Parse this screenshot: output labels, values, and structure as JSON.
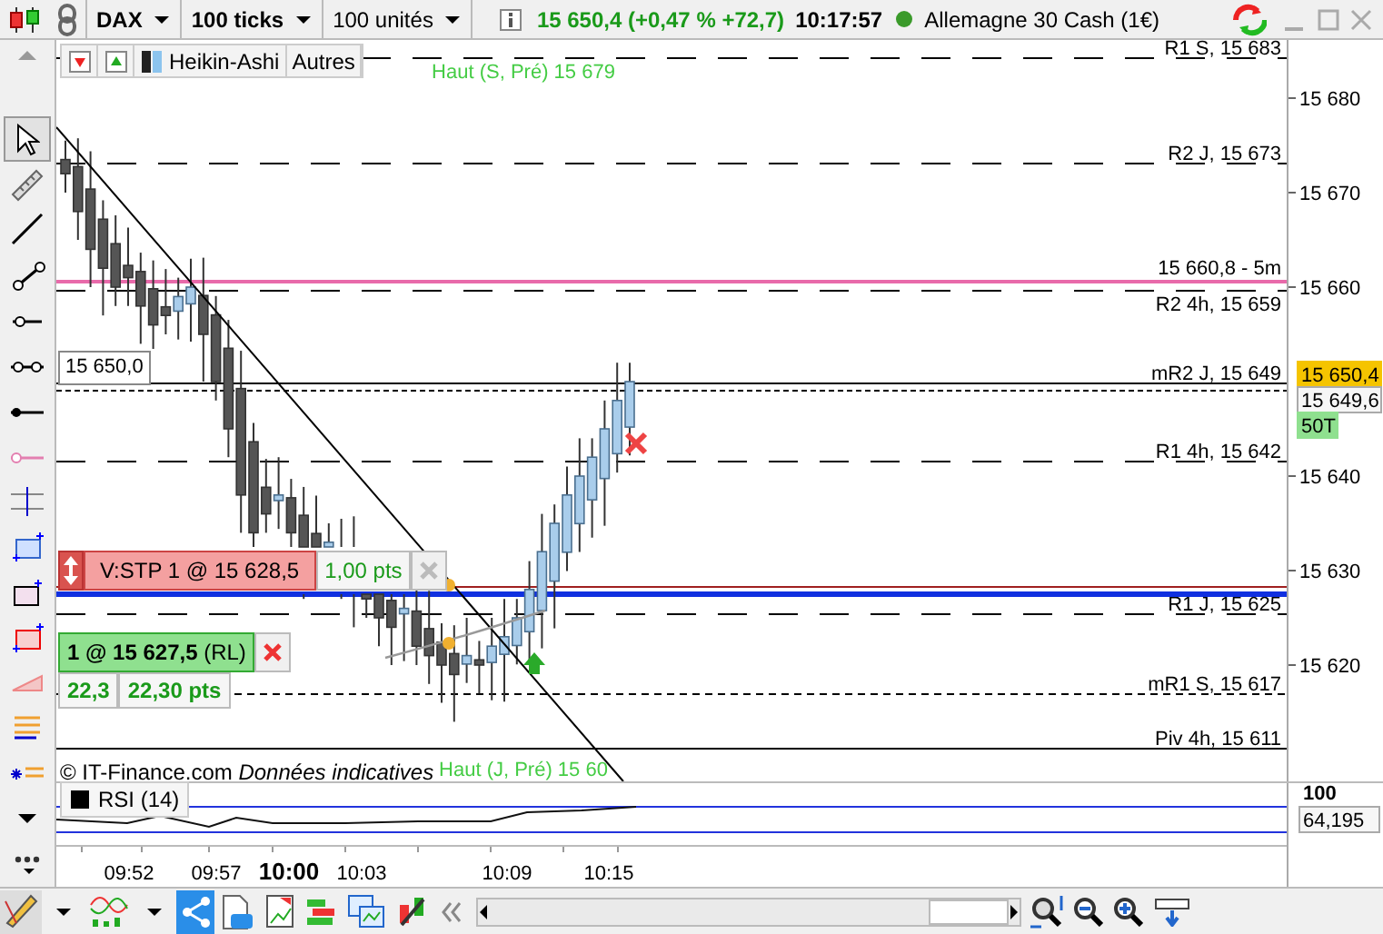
{
  "toolbar": {
    "instrument": "DAX",
    "period": "100 ticks",
    "quantity": "100 unités",
    "quote": "15 650,4 (+0,47 % +72,7)",
    "time": "10:17:57",
    "market": "Allemagne 30 Cash (1€)"
  },
  "legend": {
    "chart_type": "Heikin-Ashi",
    "others": "Autres"
  },
  "levels": [
    {
      "label": "R1 S, 15 683",
      "kind": "long-dash"
    },
    {
      "label": "Haut (S, Pré) 15 679",
      "kind": "high"
    },
    {
      "label": "R2 J, 15 673",
      "kind": "long-dash"
    },
    {
      "label": "15 660,8 - 5m",
      "kind": "marker"
    },
    {
      "label": "R2 4h, 15 659",
      "kind": "long-dash"
    },
    {
      "label": "mR2 J, 15 649",
      "kind": "solid"
    },
    {
      "label": "R1 4h, 15 642",
      "kind": "long-dash"
    },
    {
      "label": "R1 J, 15 625",
      "kind": "long-dash"
    },
    {
      "label": "mR1 S, 15 617",
      "kind": "short-dash"
    },
    {
      "label": "Piv 4h, 15 611",
      "kind": "solid"
    },
    {
      "label": "Haut (J, Pré) 15 60",
      "kind": "high"
    }
  ],
  "price_axis": {
    "ticks": [
      "15 680",
      "15 670",
      "15 660",
      "15 640",
      "15 630",
      "15 620"
    ],
    "last_price": "15 650,4",
    "bid": "15 649,6",
    "volume": "50T"
  },
  "cursor_label": "15 650,0",
  "orders": [
    {
      "kind": "stop",
      "label": "V:STP 1 @ 15 628,5",
      "distance": "1,00 pts"
    },
    {
      "kind": "position",
      "label": "**1 @ 15 627,5** (RL)",
      "pnl": "22,3",
      "pnl_points": "22,30 pts"
    }
  ],
  "notice": "© IT-Finance.com *Données indicatives*",
  "rsi": {
    "label": "RSI (14)",
    "tick": "100",
    "value": "64,195"
  },
  "time_axis": [
    {
      "label": "09:52",
      "bold": false
    },
    {
      "label": "09:57",
      "bold": false
    },
    {
      "label": "10:00",
      "bold": true
    },
    {
      "label": "10:03",
      "bold": false
    },
    {
      "label": "10:09",
      "bold": false
    },
    {
      "label": "10:15",
      "bold": false
    }
  ]
}
